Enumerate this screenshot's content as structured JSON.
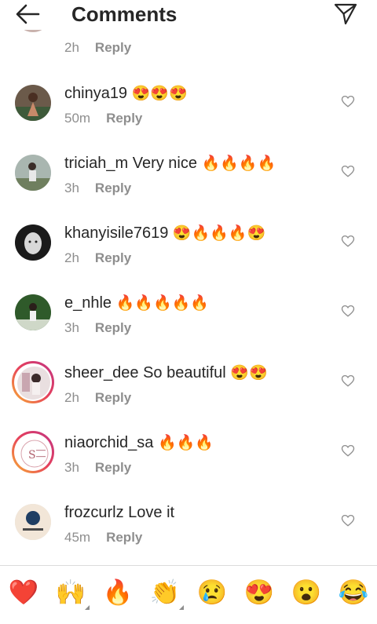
{
  "header": {
    "title": "Comments"
  },
  "partial_comment": {
    "time": "2h",
    "reply_label": "Reply"
  },
  "comments": [
    {
      "username": "chinya19",
      "text": "",
      "emojis": "😍😍😍",
      "time": "50m",
      "reply_label": "Reply"
    },
    {
      "username": "triciah_m",
      "text": "Very nice",
      "emojis": "🔥🔥🔥🔥",
      "time": "3h",
      "reply_label": "Reply"
    },
    {
      "username": "khanyisile7619",
      "text": "",
      "emojis": "😍🔥🔥🔥😍",
      "time": "2h",
      "reply_label": "Reply"
    },
    {
      "username": "e_nhle",
      "text": "",
      "emojis": "🔥🔥🔥🔥🔥",
      "time": "3h",
      "reply_label": "Reply"
    },
    {
      "username": "sheer_dee",
      "text": "So beautiful",
      "emojis": "😍😍",
      "time": "2h",
      "reply_label": "Reply"
    },
    {
      "username": "niaorchid_sa",
      "text": "",
      "emojis": "🔥🔥🔥",
      "time": "3h",
      "reply_label": "Reply"
    },
    {
      "username": "frozcurlz",
      "text": "Love it",
      "emojis": "",
      "time": "45m",
      "reply_label": "Reply"
    }
  ],
  "reactions": [
    "❤️",
    "🙌",
    "🔥",
    "👏",
    "😢",
    "😍",
    "😮",
    "😂"
  ],
  "colors": {
    "heart_red": "#ed4956",
    "muted": "#8e8e8e",
    "text": "#262626"
  }
}
